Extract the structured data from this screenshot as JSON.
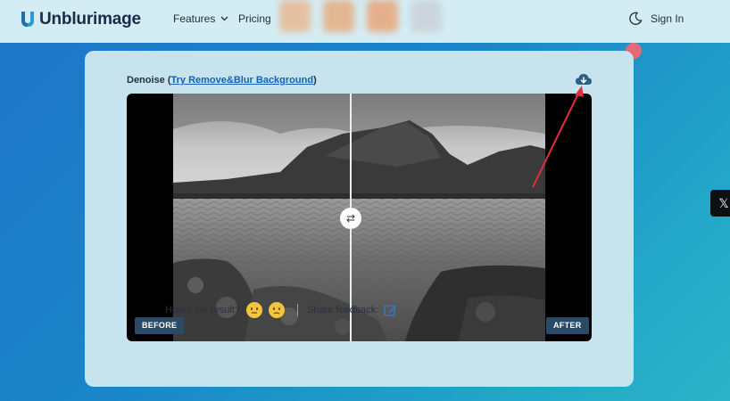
{
  "brand": {
    "name": "Unblurimage",
    "color": "#1b2b48",
    "accent": "#2a9bd3"
  },
  "nav": {
    "features": "Features",
    "pricing": "Pricing",
    "sign_in": "Sign In",
    "theme_icon": "moon-icon"
  },
  "panel": {
    "title_prefix": "Denoise (",
    "title_link": "Try Remove&Blur Background",
    "title_suffix": ")",
    "download_icon": "cloud-download-icon"
  },
  "viewer": {
    "before_label": "BEFORE",
    "after_label": "AFTER",
    "handle_glyph": "⇄",
    "slider_fraction": 0.5
  },
  "feedback": {
    "question": "How's the result?",
    "share_label": "Share feedback:",
    "good_icon": "neutral-face-icon",
    "bad_icon": "unamused-face-icon",
    "edit_icon": "edit-icon"
  },
  "social": {
    "x_label": "𝕏"
  },
  "colors": {
    "tag_bg": "#2b4a66",
    "link": "#1760b8",
    "close": "#e46a78",
    "arrow": "#e0303c"
  }
}
